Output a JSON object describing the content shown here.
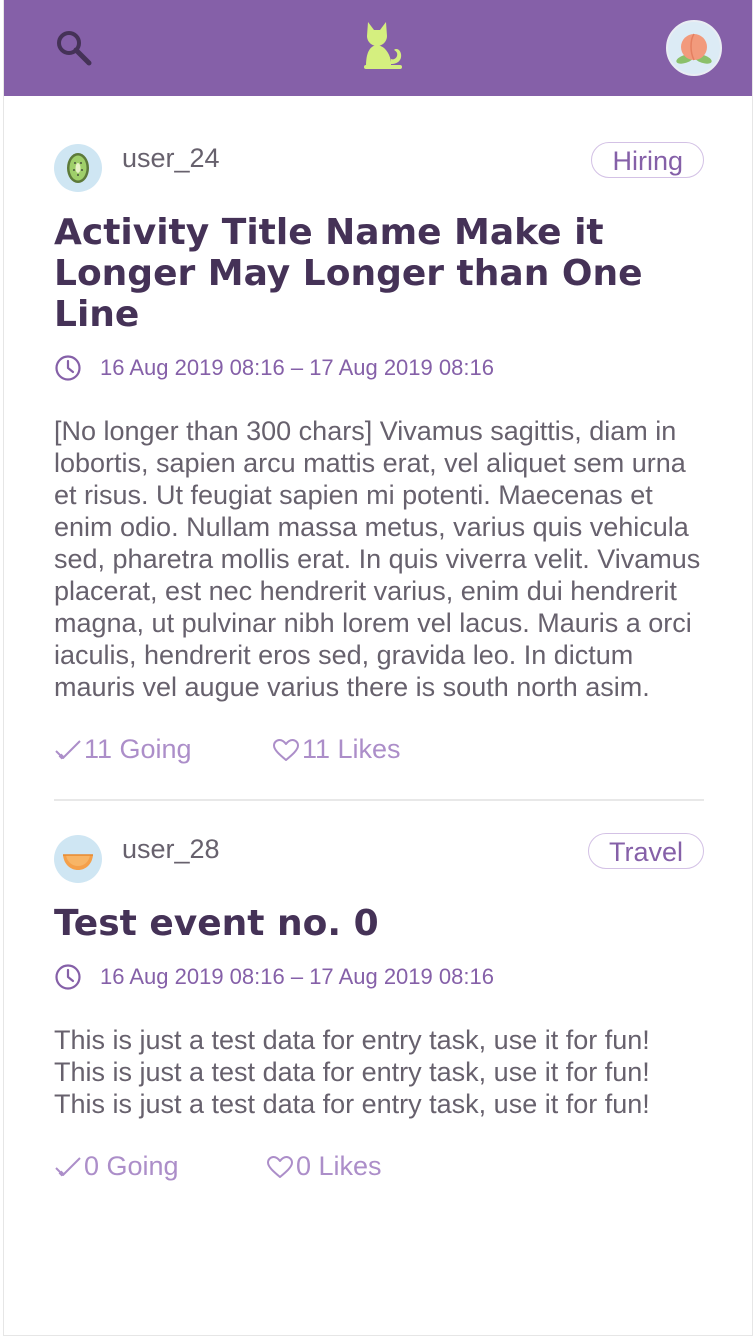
{
  "header": {
    "search_icon": "search-icon",
    "logo_icon": "cat-icon",
    "profile_icon": "peach-avatar-icon",
    "background_color": "#8560a8",
    "logo_color": "#d5ef7f"
  },
  "events": [
    {
      "username": "user_24",
      "avatar_icon": "kiwi-avatar-icon",
      "channel": "Hiring",
      "title": "Activity Title Name Make it Longer May Longer than One Line",
      "time": "16 Aug 2019 08:16 – 17 Aug 2019 08:16",
      "description": "[No longer than 300 chars] Vivamus sagittis, diam in lobortis, sapien arcu mattis erat, vel aliquet sem urna et risus. Ut feugiat sapien mi potenti. Maecenas et enim odio. Nullam massa metus, varius quis vehicula sed, pharetra mollis erat. In quis viverra velit. Vivamus placerat, est nec hendrerit varius, enim dui hendrerit magna, ut pulvinar nibh lorem vel lacus. Mauris a orci iaculis, hendrerit eros sed, gravida leo. In dictum mauris vel augue varius there is south north asim.",
      "going": "11 Going",
      "likes": "11 Likes"
    },
    {
      "username": "user_28",
      "avatar_icon": "melon-avatar-icon",
      "channel": "Travel",
      "title": "Test event no. 0",
      "time": "16 Aug 2019 08:16 – 17 Aug 2019 08:16",
      "description": "This is just a test data for entry task, use it for fun! This is just a test data for entry task, use it for fun! This is just a test data for entry task, use it for fun!",
      "going": "0 Going",
      "likes": "0 Likes"
    }
  ],
  "colors": {
    "accent": "#8560a8",
    "title": "#453257",
    "body_text": "#67616d",
    "muted_accent": "#ac8ec9"
  }
}
